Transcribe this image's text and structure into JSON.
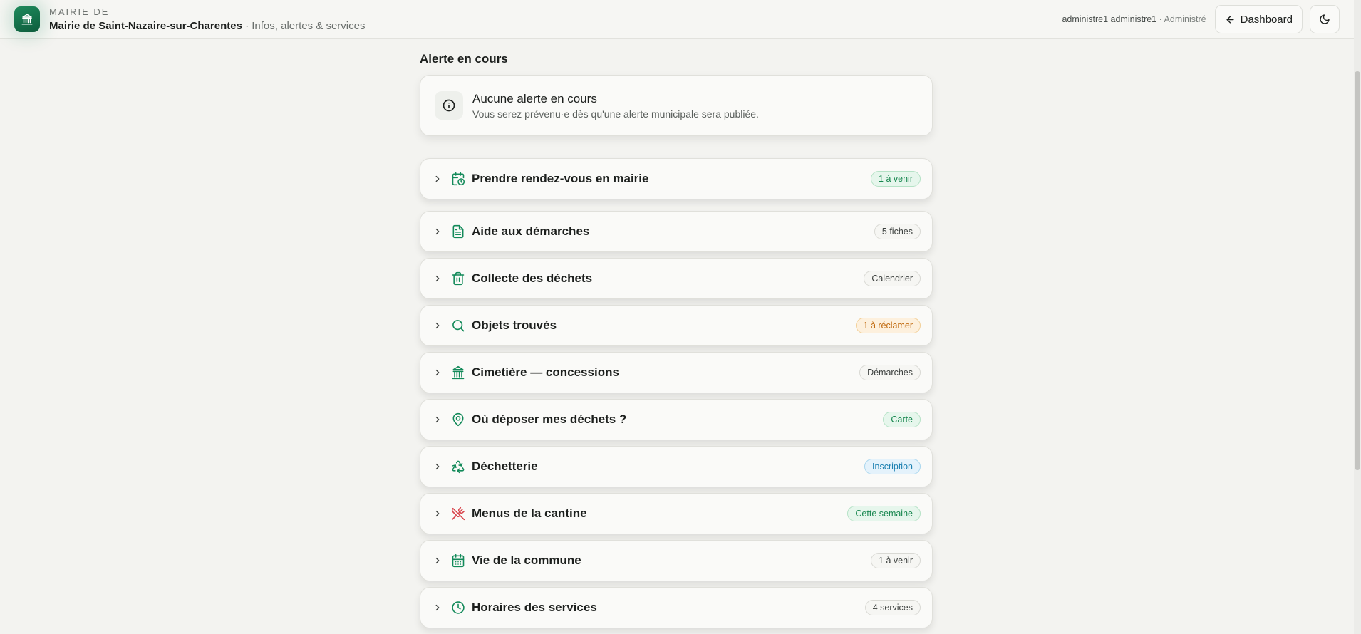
{
  "header": {
    "brand_top": "MAIRIE DE",
    "brand_name": "Mairie de Saint-Nazaire-sur-Charentes",
    "brand_sub": " · Infos, alertes & services",
    "user": "administre1 administre1",
    "role": " · Administré",
    "dashboard_label": "Dashboard",
    "logo_icon": "building-icon",
    "theme_icon": "moon-icon"
  },
  "alert_section": {
    "title": "Alerte en cours",
    "card_title": "Aucune alerte en cours",
    "card_text": "Vous serez prévenu·e dès qu'une alerte municipale sera publiée.",
    "icon": "info-icon"
  },
  "services": [
    {
      "label": "Prendre rendez-vous en mairie",
      "badge": "1 à venir",
      "badge_style": "green",
      "icon": "calendar-clock-icon"
    },
    {
      "label": "Aide aux démarches",
      "badge": "5 fiches",
      "badge_style": "neutral",
      "icon": "document-icon"
    },
    {
      "label": "Collecte des déchets",
      "badge": "Calendrier",
      "badge_style": "neutral",
      "icon": "trash-icon"
    },
    {
      "label": "Objets trouvés",
      "badge": "1 à réclamer",
      "badge_style": "orange",
      "icon": "search-icon"
    },
    {
      "label": "Cimetière — concessions",
      "badge": "Démarches",
      "badge_style": "neutral",
      "icon": "landmark-icon"
    },
    {
      "label": "Où déposer mes déchets ?",
      "badge": "Carte",
      "badge_style": "green",
      "icon": "map-pin-icon"
    },
    {
      "label": "Déchetterie",
      "badge": "Inscription",
      "badge_style": "blue",
      "icon": "recycle-icon"
    },
    {
      "label": "Menus de la cantine",
      "badge": "Cette semaine",
      "badge_style": "green",
      "icon": "utensils-crossed-icon"
    },
    {
      "label": "Vie de la commune",
      "badge": "1 à venir",
      "badge_style": "neutral",
      "icon": "calendar-icon"
    },
    {
      "label": "Horaires des services",
      "badge": "4 services",
      "badge_style": "neutral",
      "icon": "clock-icon"
    }
  ],
  "colors": {
    "accent": "#138a5a",
    "background": "#f3f3f0",
    "card": "#fafaf8",
    "cantine_icon": "#d8434b"
  }
}
